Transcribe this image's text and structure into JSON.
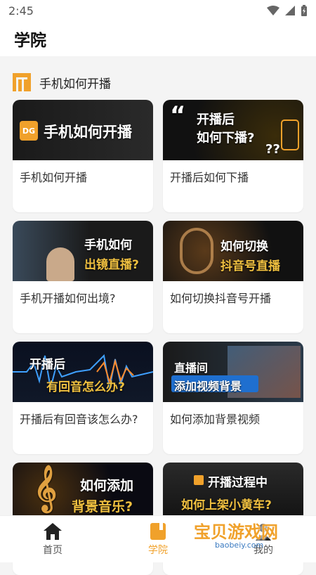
{
  "status_bar": {
    "time": "2:45"
  },
  "header": {
    "title": "学院"
  },
  "section": {
    "title": "手机如何开播"
  },
  "cards": [
    {
      "title": "手机如何开播",
      "thumb_text": "手机如何开播",
      "thumb_logo": "DG"
    },
    {
      "title": "开播后如何下播",
      "thumb_text_line1": "开播后",
      "thumb_text_line2": "如何下播?",
      "quote_mark": "“",
      "question_mark": "??"
    },
    {
      "title": "手机开播如何出境?",
      "thumb_text_line1": "手机如何",
      "thumb_text_line2": "出镜直播?"
    },
    {
      "title": "如何切换抖音号开播",
      "thumb_text_line1": "如何切换",
      "thumb_text_line2": "抖音号直播"
    },
    {
      "title": "开播后有回音该怎么办?",
      "thumb_text_line1": "开播后",
      "thumb_text_line2": "有回音怎么办?"
    },
    {
      "title": "如何添加背景视频",
      "thumb_text_line1": "直播间",
      "thumb_text_line2": "添加视频背景"
    },
    {
      "title": "",
      "thumb_text_line1": "如何添加",
      "thumb_text_line2": "背景音乐?"
    },
    {
      "title": "",
      "thumb_text_line1": "开播过程中",
      "thumb_text_line2": "如何上架小黄车?"
    }
  ],
  "bottom_nav": [
    {
      "label": "首页",
      "icon": "home-icon",
      "active": false
    },
    {
      "label": "学院",
      "icon": "book-icon",
      "active": true
    },
    {
      "label": "我的",
      "icon": "user-icon",
      "active": false
    }
  ],
  "watermark": {
    "text": "宝贝游戏网",
    "url": "baobeiy.com"
  },
  "colors": {
    "accent": "#f0a12b",
    "background": "#f4f4f4"
  }
}
